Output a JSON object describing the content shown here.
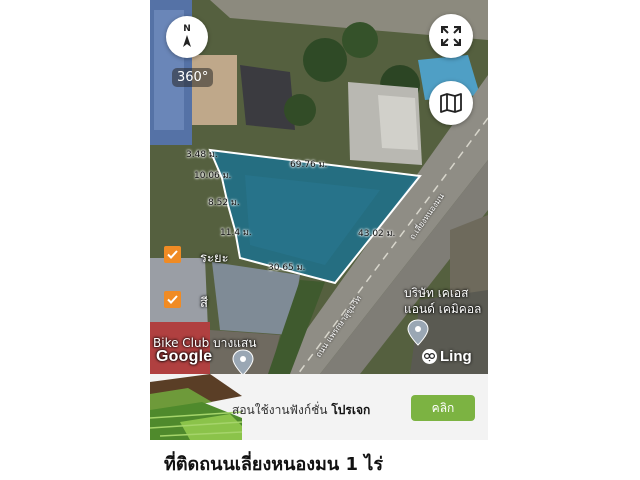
{
  "map": {
    "btn_360": "360°",
    "compass_letter": "N",
    "dimensions": [
      "3.48 ม.",
      "69.76 ม.",
      "10.06 ม.",
      "8.52 ม.",
      "11.4 ม.",
      "43.02 ม.",
      "30.65 ม."
    ],
    "checkbox_1_label": "ระยะ",
    "checkbox_2_label": "สี",
    "place_bike_club": "Bike Club บางแสน",
    "place_company_line1": "บริษัท เคเอส",
    "place_company_line2": "แอนด์ เคมิคอล",
    "road_label_1": "ถ.เลี่ยงหนองมน",
    "road_label_2": "ถนน แพรกษาสุขุมวิท",
    "google_label": "Google",
    "brand_name": "Ling",
    "colors": {
      "parcel_fill": "#1f6f8b",
      "parcel_stroke": "#ffffff",
      "checkbox": "#f08b24"
    },
    "icons": [
      "compass-icon",
      "fullscreen-icon",
      "map-layers-icon",
      "check-icon",
      "location-pin-icon",
      "owl-logo-icon"
    ]
  },
  "banner": {
    "text_prefix": "สอนใช้งานฟังก์ชั่น",
    "text_bold": "โปรเจก",
    "cta_label": "คลิก",
    "cta_color": "#7cb342"
  },
  "listing": {
    "title": "ที่ติดถนนเลี่ยงหนองมน 1 ไร่"
  }
}
